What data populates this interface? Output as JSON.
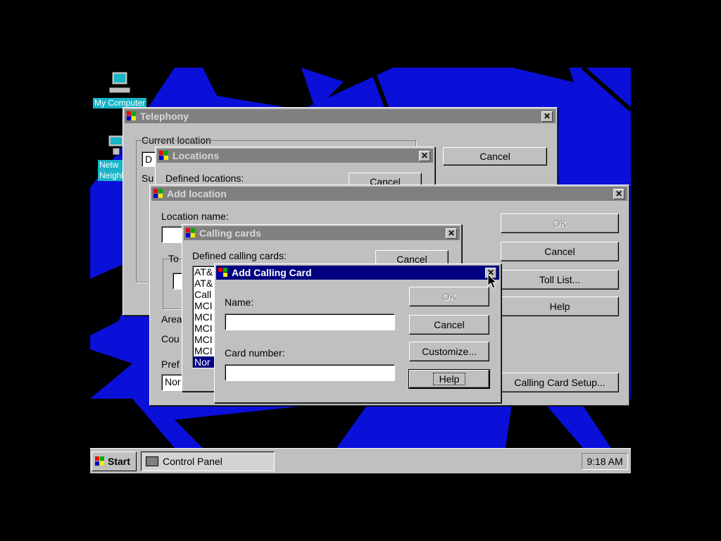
{
  "desktop": {
    "icons": [
      {
        "label": "My Computer"
      },
      {
        "label": "Network Neighborhood",
        "label_line1": "Netw",
        "label_line2": "Neighb"
      }
    ]
  },
  "telephony": {
    "title": "Telephony",
    "current_location_label": "Current location",
    "location_value": "D",
    "partial_label": "Su",
    "cancel": "Cancel"
  },
  "locations": {
    "title": "Locations",
    "defined_label": "Defined locations:",
    "cancel": "Cancel"
  },
  "add_location": {
    "title": "Add location",
    "location_name_label": "Location name:",
    "group_label_partial": "To",
    "area_partial": "Area",
    "country_partial": "Cou",
    "prefix_partial": "Pref",
    "prefix_value_partial": "Nor",
    "ok": "OK",
    "cancel": "Cancel",
    "toll_list": "Toll List...",
    "help": "Help",
    "calling_card_setup": "Calling Card Setup..."
  },
  "calling_cards": {
    "title": "Calling cards",
    "defined_label": "Defined calling cards:",
    "cancel": "Cancel",
    "list_items": [
      "AT&",
      "AT&",
      "Call",
      "MCI",
      "MCI",
      "MCI",
      "MCI",
      "MCI",
      "Nor"
    ]
  },
  "add_card": {
    "title": "Add Calling Card",
    "name_label": "Name:",
    "name_value": "",
    "card_number_label": "Card number:",
    "card_number_value": "",
    "ok": "OK",
    "cancel": "Cancel",
    "customize": "Customize...",
    "help": "Help"
  },
  "taskbar": {
    "start": "Start",
    "task": "Control Panel",
    "clock": "9:18 AM"
  },
  "colors": {
    "desktop_blue": "#0a10d8",
    "active_title": "#000080",
    "inactive_title": "#808080",
    "face": "#c0c0c0"
  }
}
